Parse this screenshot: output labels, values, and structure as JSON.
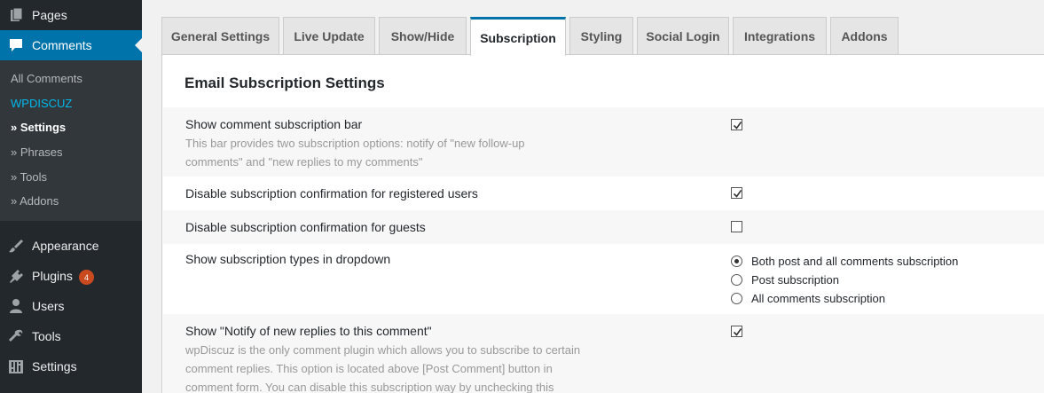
{
  "sidebar": {
    "pages": "Pages",
    "comments": "Comments",
    "submenu": {
      "all_comments": "All Comments",
      "wpdiscuz": "wpDiscuz",
      "settings": "» Settings",
      "phrases": "» Phrases",
      "tools": "» Tools",
      "addons": "» Addons"
    },
    "appearance": "Appearance",
    "plugins": "Plugins",
    "plugins_badge": "4",
    "users": "Users",
    "tools": "Tools",
    "settings": "Settings",
    "colors": {
      "bg": "#23282d",
      "active": "#0073aa",
      "badge": "#ca4a1f",
      "brand": "#00b9eb"
    }
  },
  "tabs": [
    "General Settings",
    "Live Update",
    "Show/Hide",
    "Subscription",
    "Styling",
    "Social Login",
    "Integrations",
    "Addons"
  ],
  "active_tab": "Subscription",
  "panel": {
    "title": "Email Subscription Settings",
    "rows": [
      {
        "label": "Show comment subscription bar",
        "description": "This bar provides two subscription options: notify of \"new follow-up comments\" and \"new replies to my comments\"",
        "checked": true
      },
      {
        "label": "Disable subscription confirmation for registered users",
        "checked": true
      },
      {
        "label": "Disable subscription confirmation for guests",
        "checked": false
      },
      {
        "label": "Show subscription types in dropdown",
        "options": [
          {
            "label": "Both post and all comments subscription",
            "selected": true
          },
          {
            "label": "Post subscription",
            "selected": false
          },
          {
            "label": "All comments subscription",
            "selected": false
          }
        ]
      },
      {
        "label": "Show \"Notify of new replies to this comment\"",
        "description": "wpDiscuz is the only comment plugin which allows you to subscribe to certain comment replies. This option is located above [Post Comment] button in comment form. You can disable this subscription way by unchecking this",
        "checked": true
      }
    ]
  }
}
